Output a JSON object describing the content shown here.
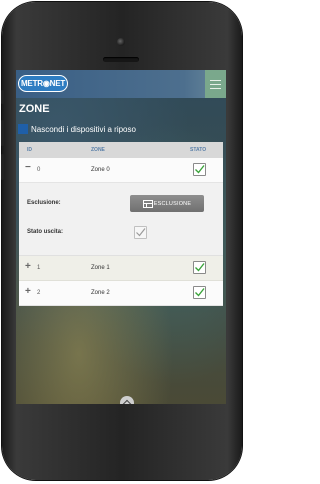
{
  "app": {
    "logo_text": "METR◉NET"
  },
  "page": {
    "title": "ZONE",
    "hide_resting_label": "Nascondi i dispositivi a riposo"
  },
  "table": {
    "headers": {
      "id": "ID",
      "zone": "ZONE",
      "status": "STATO"
    },
    "rows": [
      {
        "expander": "−",
        "id": "0",
        "name": "Zone 0",
        "status_checked": true,
        "expanded": true
      },
      {
        "expander": "+",
        "id": "1",
        "name": "Zone 1",
        "status_checked": true,
        "expanded": false
      },
      {
        "expander": "+",
        "id": "2",
        "name": "Zone 2",
        "status_checked": true,
        "expanded": false
      }
    ],
    "detail": {
      "exclusion_label": "Esclusione:",
      "exclusion_button": "ESCLUSIONE",
      "output_state_label": "Stato uscita:",
      "output_state_checked": true
    }
  },
  "colors": {
    "topbar": "#3a5f85",
    "accent_check": "#3aa33a",
    "header_text": "#5a7fa8"
  }
}
